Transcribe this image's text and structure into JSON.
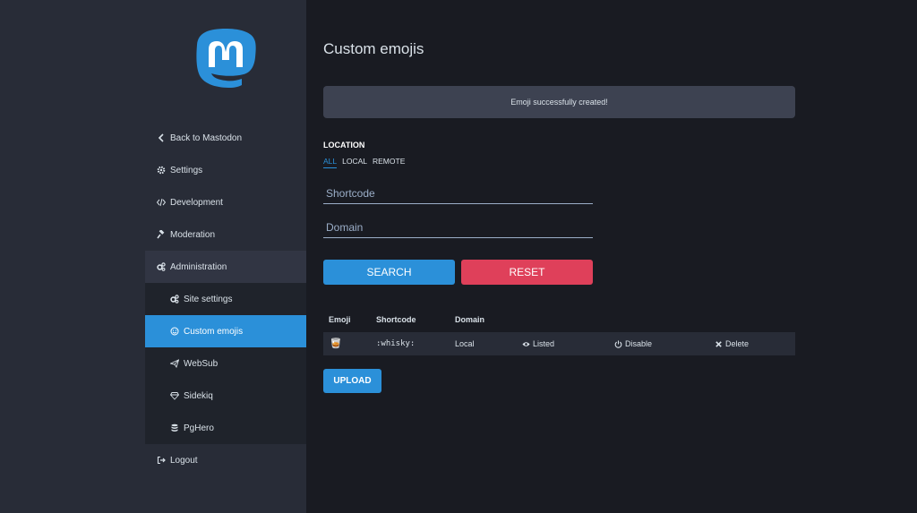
{
  "sidebar": {
    "items": [
      {
        "label": "Back to Mastodon",
        "icon": "chevron-left-icon"
      },
      {
        "label": "Settings",
        "icon": "cog-icon"
      },
      {
        "label": "Development",
        "icon": "code-icon"
      },
      {
        "label": "Moderation",
        "icon": "gavel-icon"
      },
      {
        "label": "Administration",
        "icon": "cogs-icon"
      }
    ],
    "subitems": [
      {
        "label": "Site settings",
        "icon": "cogs-icon"
      },
      {
        "label": "Custom emojis",
        "icon": "smile-icon"
      },
      {
        "label": "WebSub",
        "icon": "paper-plane-icon"
      },
      {
        "label": "Sidekiq",
        "icon": "diamond-icon"
      },
      {
        "label": "PgHero",
        "icon": "database-icon"
      }
    ],
    "logout": {
      "label": "Logout",
      "icon": "sign-out-icon"
    }
  },
  "main": {
    "title": "Custom emojis",
    "flash": "Emoji successfully created!",
    "filter": {
      "label": "LOCATION",
      "options": [
        "ALL",
        "LOCAL",
        "REMOTE"
      ],
      "selected": "ALL"
    },
    "search": {
      "shortcode_placeholder": "Shortcode",
      "domain_placeholder": "Domain",
      "search_label": "SEARCH",
      "reset_label": "RESET"
    },
    "table": {
      "headers": [
        "Emoji",
        "Shortcode",
        "Domain"
      ],
      "rows": [
        {
          "emoji": "🥃",
          "shortcode": ":whisky:",
          "domain": "Local",
          "listed": "Listed",
          "disable": "Disable",
          "delete": "Delete"
        }
      ]
    },
    "upload_label": "UPLOAD"
  },
  "colors": {
    "accent": "#2b90d9",
    "danger": "#df405a",
    "sidebar_bg": "#282c37",
    "main_bg": "#191b22"
  }
}
